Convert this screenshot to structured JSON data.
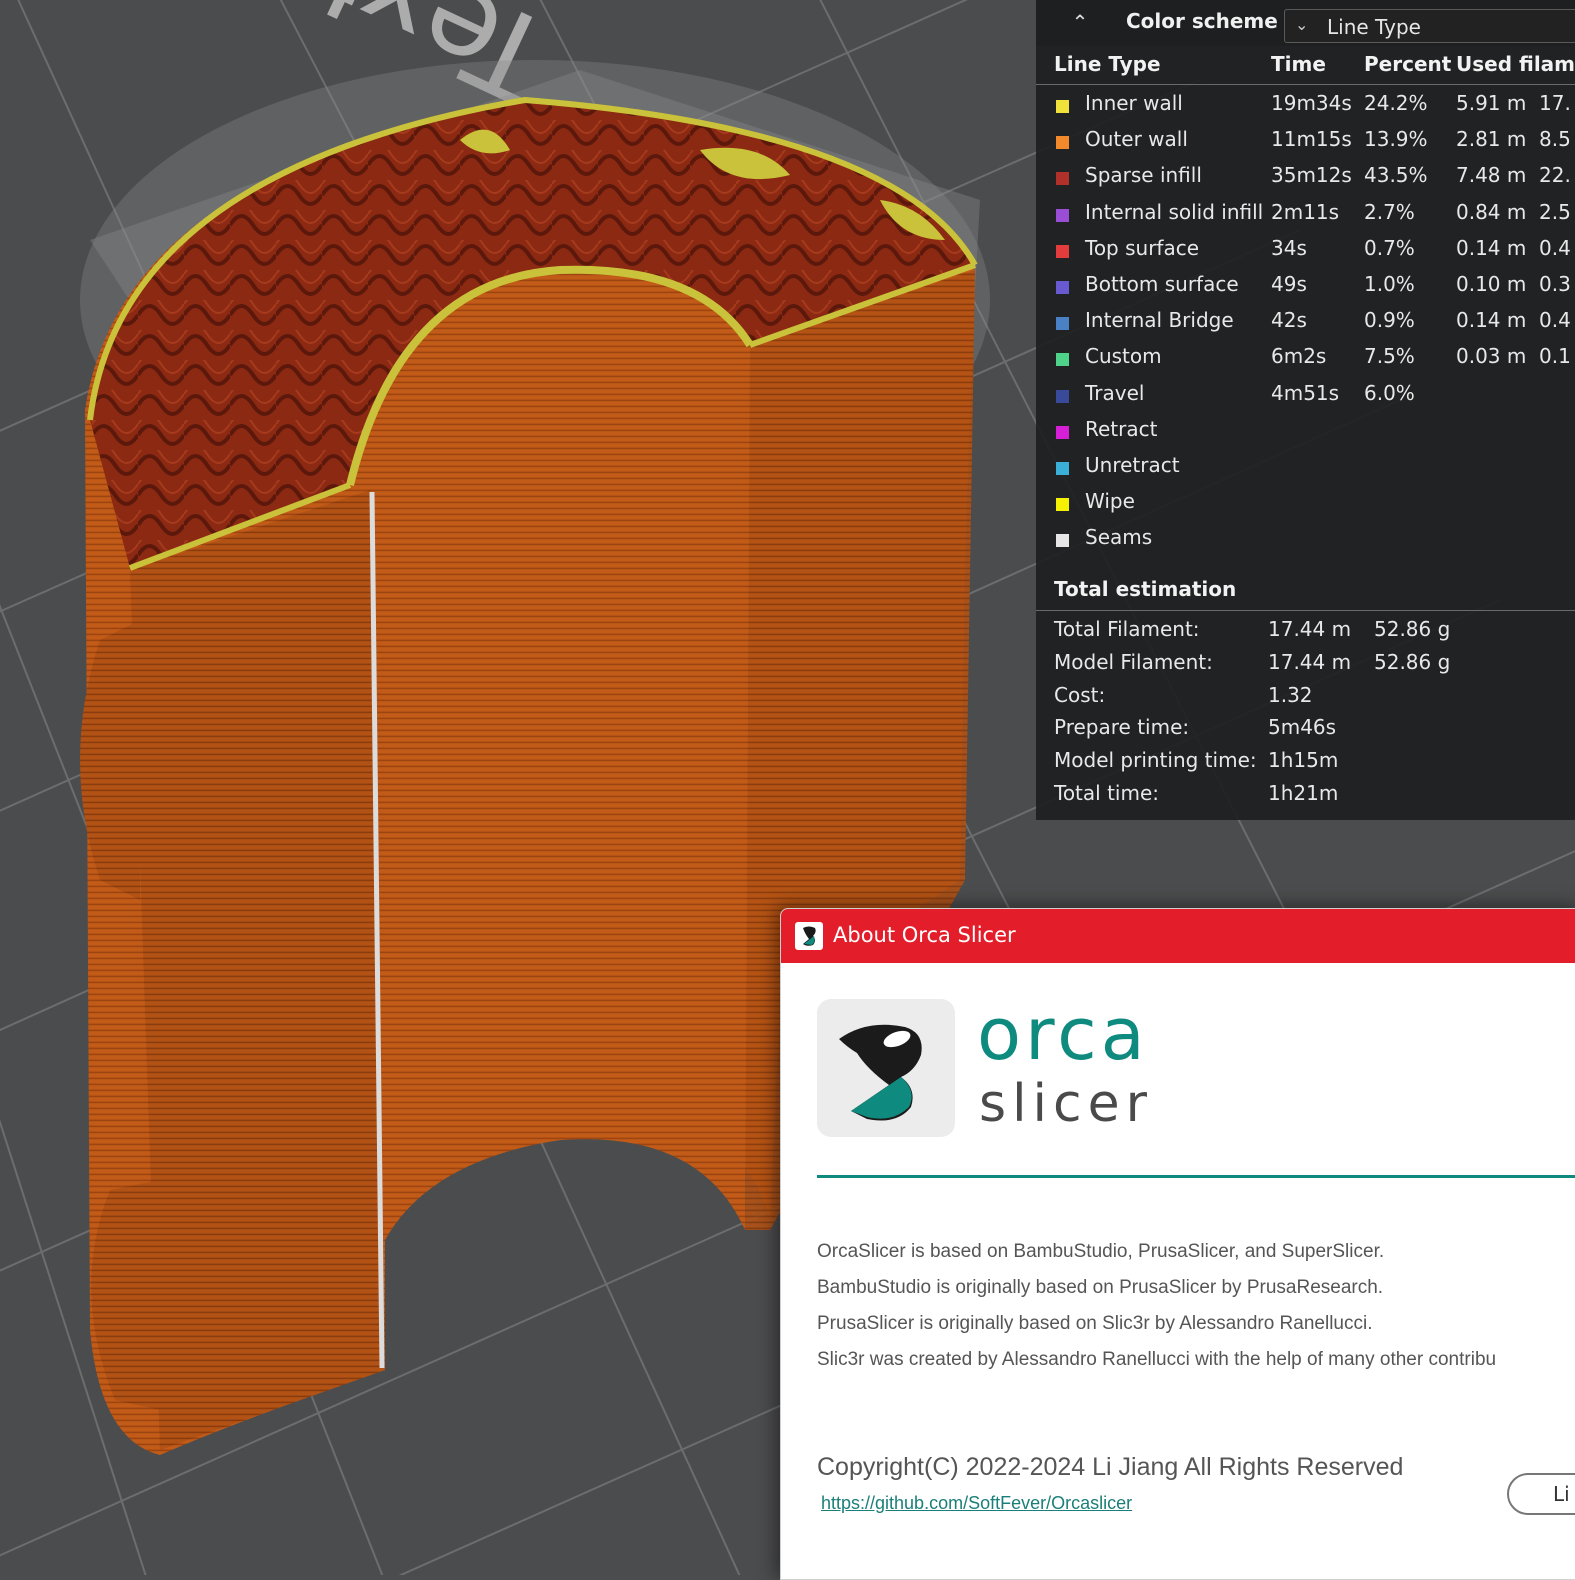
{
  "viewport": {
    "plate_texture_label": "Textured",
    "colors": {
      "plate": "#4b4c4d",
      "outer_wall": "#c15a17",
      "sparse_infill": "#8a2a14",
      "inner_wall": "#c9c23a",
      "seam": "#d9d9d9"
    }
  },
  "legend": {
    "color_scheme_label": "Color scheme",
    "color_scheme_value": "Line Type",
    "columns": [
      "Line Type",
      "Time",
      "Percent",
      "Used filam"
    ],
    "rows": [
      {
        "name": "Inner wall",
        "color": "#f0e23a",
        "time": "19m34s",
        "percent": "24.2%",
        "used_m": "5.91 m",
        "used_g": "17."
      },
      {
        "name": "Outer wall",
        "color": "#f28a2c",
        "time": "11m15s",
        "percent": "13.9%",
        "used_m": "2.81 m",
        "used_g": "8.5"
      },
      {
        "name": "Sparse infill",
        "color": "#b0302a",
        "time": "35m12s",
        "percent": "43.5%",
        "used_m": "7.48 m",
        "used_g": "22."
      },
      {
        "name": "Internal solid infill",
        "color": "#9a4ed6",
        "time": "2m11s",
        "percent": "2.7%",
        "used_m": "0.84 m",
        "used_g": "2.5"
      },
      {
        "name": "Top surface",
        "color": "#e23c3c",
        "time": "34s",
        "percent": "0.7%",
        "used_m": "0.14 m",
        "used_g": "0.4"
      },
      {
        "name": "Bottom surface",
        "color": "#6a5ad2",
        "time": "49s",
        "percent": "1.0%",
        "used_m": "0.10 m",
        "used_g": "0.3"
      },
      {
        "name": "Internal Bridge",
        "color": "#4a80c4",
        "time": "42s",
        "percent": "0.9%",
        "used_m": "0.14 m",
        "used_g": "0.4"
      },
      {
        "name": "Custom",
        "color": "#4fd38a",
        "time": "6m2s",
        "percent": "7.5%",
        "used_m": "0.03 m",
        "used_g": "0.1"
      },
      {
        "name": "Travel",
        "color": "#3a4a9a",
        "time": "4m51s",
        "percent": "6.0%",
        "used_m": "",
        "used_g": ""
      },
      {
        "name": "Retract",
        "color": "#d81fd8",
        "time": "",
        "percent": "",
        "used_m": "",
        "used_g": ""
      },
      {
        "name": "Unretract",
        "color": "#3ab0d8",
        "time": "",
        "percent": "",
        "used_m": "",
        "used_g": ""
      },
      {
        "name": "Wipe",
        "color": "#f5f000",
        "time": "",
        "percent": "",
        "used_m": "",
        "used_g": ""
      },
      {
        "name": "Seams",
        "color": "#e6e6e6",
        "time": "",
        "percent": "",
        "used_m": "",
        "used_g": ""
      }
    ],
    "total_title": "Total estimation",
    "totals": [
      {
        "label": "Total Filament:",
        "v1": "17.44 m",
        "v2": "52.86 g"
      },
      {
        "label": "Model Filament:",
        "v1": "17.44 m",
        "v2": "52.86 g"
      },
      {
        "label": "Cost:",
        "v1": "1.32",
        "v2": ""
      },
      {
        "label": "Prepare time:",
        "v1": "5m46s",
        "v2": ""
      },
      {
        "label": "Model printing time:",
        "v1": "1h15m",
        "v2": ""
      },
      {
        "label": "Total time:",
        "v1": "1h21m",
        "v2": ""
      }
    ]
  },
  "about": {
    "title": "About Orca Slicer",
    "logo_word1": "orca",
    "logo_word2": "slicer",
    "brand_color": "#0f8a7e",
    "titlebar_color": "#e41d2a",
    "credits": [
      "OrcaSlicer is based on BambuStudio, PrusaSlicer, and SuperSlicer.",
      "BambuStudio is originally based on PrusaSlicer by PrusaResearch.",
      "PrusaSlicer is originally based on Slic3r by Alessandro Ranellucci.",
      "Slic3r was created by Alessandro Ranellucci with the help of many other contribu"
    ],
    "copyright": "Copyright(C) 2022-2024 Li Jiang All Rights Reserved",
    "link": "https://github.com/SoftFever/Orcaslicer",
    "license_button": "Li"
  }
}
